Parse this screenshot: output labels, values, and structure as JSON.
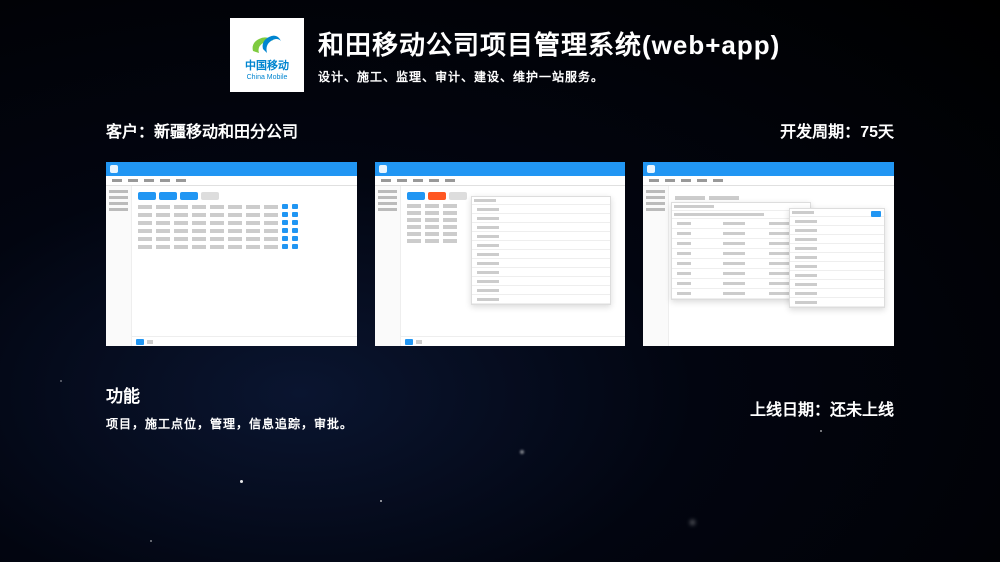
{
  "logo": {
    "name_cn": "中国移动",
    "name_en": "China Mobile"
  },
  "header": {
    "title": "和田移动公司项目管理系统(web+app)",
    "subtitle": "设计、施工、监理、审计、建设、维护一站服务。"
  },
  "client": {
    "label": "客户：",
    "value": "新疆移动和田分公司"
  },
  "dev_cycle": {
    "label": "开发周期：",
    "value": "75天"
  },
  "feature": {
    "label": "功能",
    "desc": "项目，施工点位，管理，信息追踪，审批。"
  },
  "launch": {
    "label": "上线日期：",
    "value": "还未上线"
  }
}
